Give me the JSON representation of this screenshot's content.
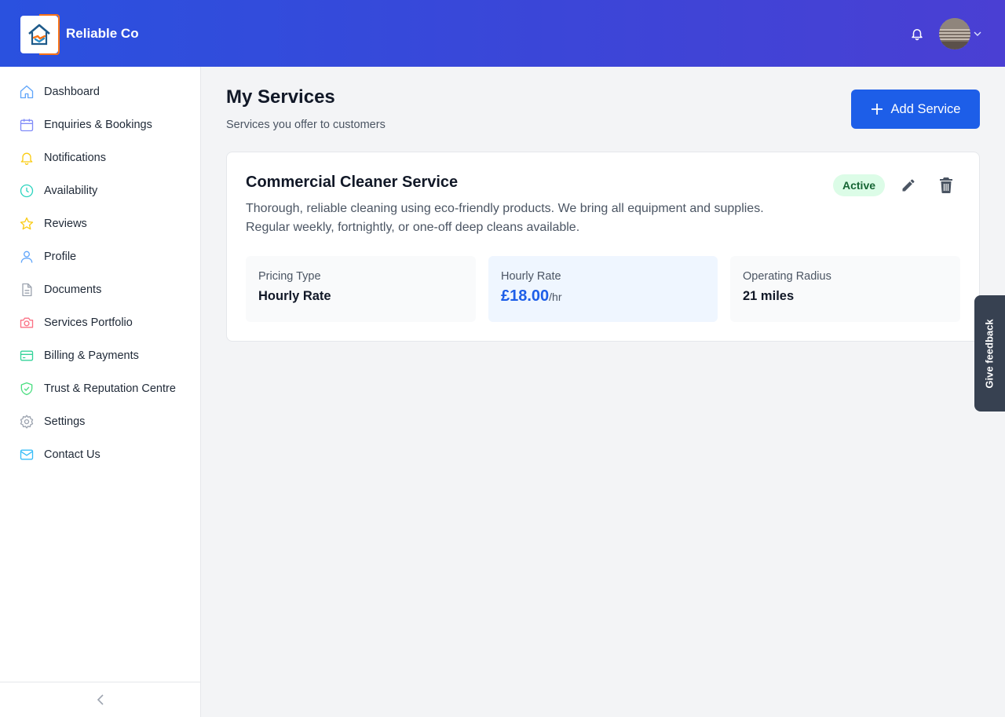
{
  "header": {
    "brand": "Reliable Co",
    "logo_icon": "house-handshake-logo",
    "accent_color": "#f97316"
  },
  "sidebar": {
    "items": [
      {
        "label": "Dashboard",
        "icon": "home-icon",
        "color": "#60a5fa"
      },
      {
        "label": "Enquiries & Bookings",
        "icon": "calendar-icon",
        "color": "#818cf8"
      },
      {
        "label": "Notifications",
        "icon": "bell-icon",
        "color": "#facc15"
      },
      {
        "label": "Availability",
        "icon": "clock-icon",
        "color": "#2dd4bf"
      },
      {
        "label": "Reviews",
        "icon": "star-icon",
        "color": "#facc15"
      },
      {
        "label": "Profile",
        "icon": "user-icon",
        "color": "#60a5fa"
      },
      {
        "label": "Documents",
        "icon": "document-icon",
        "color": "#9ca3af"
      },
      {
        "label": "Services Portfolio",
        "icon": "camera-icon",
        "color": "#fb7185"
      },
      {
        "label": "Billing & Payments",
        "icon": "credit-card-icon",
        "color": "#34d399"
      },
      {
        "label": "Trust & Reputation Centre",
        "icon": "shield-check-icon",
        "color": "#4ade80"
      },
      {
        "label": "Settings",
        "icon": "gear-icon",
        "color": "#9ca3af"
      },
      {
        "label": "Contact Us",
        "icon": "mail-icon",
        "color": "#38bdf8"
      }
    ]
  },
  "main": {
    "title": "My Services",
    "subtitle": "Services you offer to customers",
    "add_button": "Add Service"
  },
  "service": {
    "name": "Commercial Cleaner Service",
    "description": "Thorough, reliable cleaning using eco-friendly products. We bring all equipment and supplies. Regular weekly, fortnightly, or one-off deep cleans available.",
    "status": "Active",
    "pricing_type_label": "Pricing Type",
    "pricing_type_value": "Hourly Rate",
    "hourly_rate_label": "Hourly Rate",
    "hourly_rate_value": "£18.00",
    "hourly_rate_unit": "/hr",
    "radius_label": "Operating Radius",
    "radius_value": "21 miles"
  },
  "feedback": {
    "label": "Give feedback"
  },
  "colors": {
    "primary": "#1d5ee8",
    "active_badge_bg": "#dcfce7",
    "active_badge_text": "#166534"
  }
}
